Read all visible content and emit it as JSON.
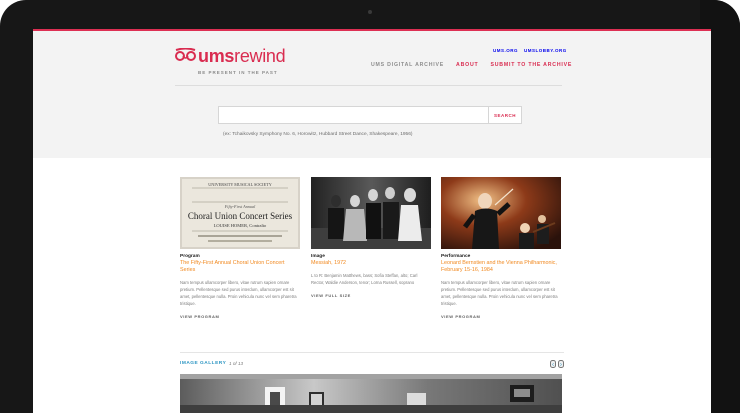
{
  "brand": {
    "logo_ums": "ums",
    "logo_rewind": "rewind",
    "tagline": "BE PRESENT IN THE PAST",
    "accent": "#d92c50"
  },
  "utility_links": [
    {
      "label": "UMS.ORG"
    },
    {
      "label": "UMSLOBBY.ORG"
    }
  ],
  "main_nav": [
    {
      "label": "UMS DIGITAL ARCHIVE"
    },
    {
      "label": "ABOUT"
    },
    {
      "label": "SUBMIT TO THE ARCHIVE"
    }
  ],
  "search": {
    "value": "",
    "placeholder": "",
    "button_label": "SEARCH",
    "hint": "(ex: Tchaikovsky Symphony No. 6, Horowitz, Hubbard Street Dance, Shakespeare, 1956)"
  },
  "cards": [
    {
      "type": "Program",
      "title": "The Fifty-First Annual Choral Union Concert Series",
      "description": "Nam tempus ullamcorper libero, vitae rutrum sapien ornare pretium. Pellentesque sed purus interdum, ullamcorper est sit amet, pellentesque nulla. Proin vehicula nunc vel sem pharetra tristique.",
      "action": "VIEW PROGRAM",
      "image": {
        "line1": "UNIVERSITY MUSICAL SOCIETY",
        "line2": "Fifty-First Annual",
        "line3": "Choral Union Concert Series",
        "line4": "LOUISE HOMER, Contralto"
      }
    },
    {
      "type": "Image",
      "title": "Messiah, 1972",
      "description": "L to R: Benjamin Matthews, bass; Sofia Steffan, alto; Carl Rector, Waldie Anderson, tenor; Lorna Russell, soprano",
      "action": "VIEW FULL SIZE"
    },
    {
      "type": "Performance",
      "title": "Leonard Bernstien and the Vienna Philharmonic, February 15-16, 1984",
      "description": "Nam tempus ullamcorper libero, vitae rutrum sapien ornare pretium. Pellentesque sed purus interdum, ullamcorper est sit amet, pellentesque nulla. Proin vehicula nunc vel sem pharetra tristique.",
      "action": "VIEW PROGRAM"
    }
  ],
  "gallery": {
    "label": "IMAGE GALLERY",
    "count": "1 of 13"
  },
  "icons": {
    "logo": "ums-logo-icon",
    "prev": "chevron-left-icon",
    "next": "chevron-right-icon"
  }
}
